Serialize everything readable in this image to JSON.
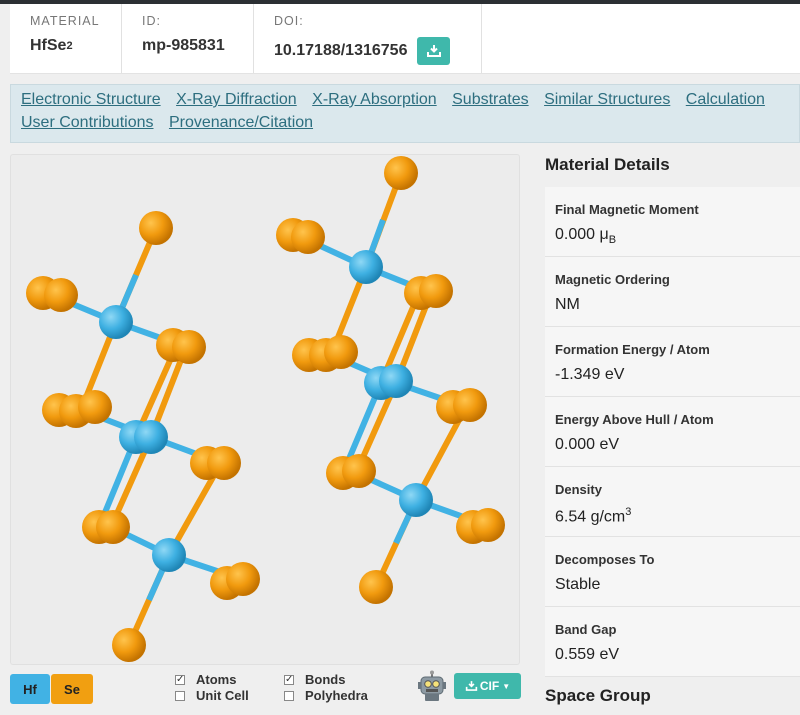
{
  "header": {
    "material_label": "MATERIAL",
    "material_formula_base": "HfSe",
    "material_formula_sub": "2",
    "id_label": "ID:",
    "id_value": "mp-985831",
    "doi_label": "DOI:",
    "doi_value": "10.17188/1316756",
    "download_icon": "download-icon"
  },
  "nav": {
    "row1": [
      "Electronic Structure",
      "X-Ray Diffraction",
      "X-Ray Absorption",
      "Substrates",
      "Similar Structures",
      "Calculation"
    ],
    "row2": [
      "User Contributions",
      "Provenance/Citation"
    ]
  },
  "viewer": {
    "legend": [
      {
        "label": "Hf",
        "color": "#41b2e4"
      },
      {
        "label": "Se",
        "color": "#f19f11"
      }
    ],
    "checkboxes": {
      "atoms": {
        "label": "Atoms",
        "checked": true
      },
      "unit_cell": {
        "label": "Unit Cell",
        "checked": false
      },
      "bonds": {
        "label": "Bonds",
        "checked": true
      },
      "polyhedra": {
        "label": "Polyhedra",
        "checked": false
      }
    },
    "export_label": "CIF",
    "robot_icon": "robot-icon"
  },
  "details": {
    "title": "Material Details",
    "magnetic_moment": {
      "label": "Final Magnetic Moment",
      "value": "0.000 μ",
      "unit_sub": "B"
    },
    "magnetic_ordering": {
      "label": "Magnetic Ordering",
      "value": "NM"
    },
    "formation_energy": {
      "label": "Formation Energy / Atom",
      "value": "-1.349 eV"
    },
    "energy_above_hull": {
      "label": "Energy Above Hull / Atom",
      "value": "0.000 eV"
    },
    "density": {
      "label": "Density",
      "value": "6.54 g/cm",
      "unit_sup": "3"
    },
    "decomposes_to": {
      "label": "Decomposes To",
      "value": "Stable"
    },
    "band_gap": {
      "label": "Band Gap",
      "value": "0.559 eV"
    }
  },
  "space_group_title": "Space Group",
  "colors": {
    "hf": "#41b2e4",
    "se": "#f19f11",
    "accent": "#3fb8ab",
    "nav_link": "#2d6e7f",
    "nav_bg": "#dbe8ed"
  }
}
